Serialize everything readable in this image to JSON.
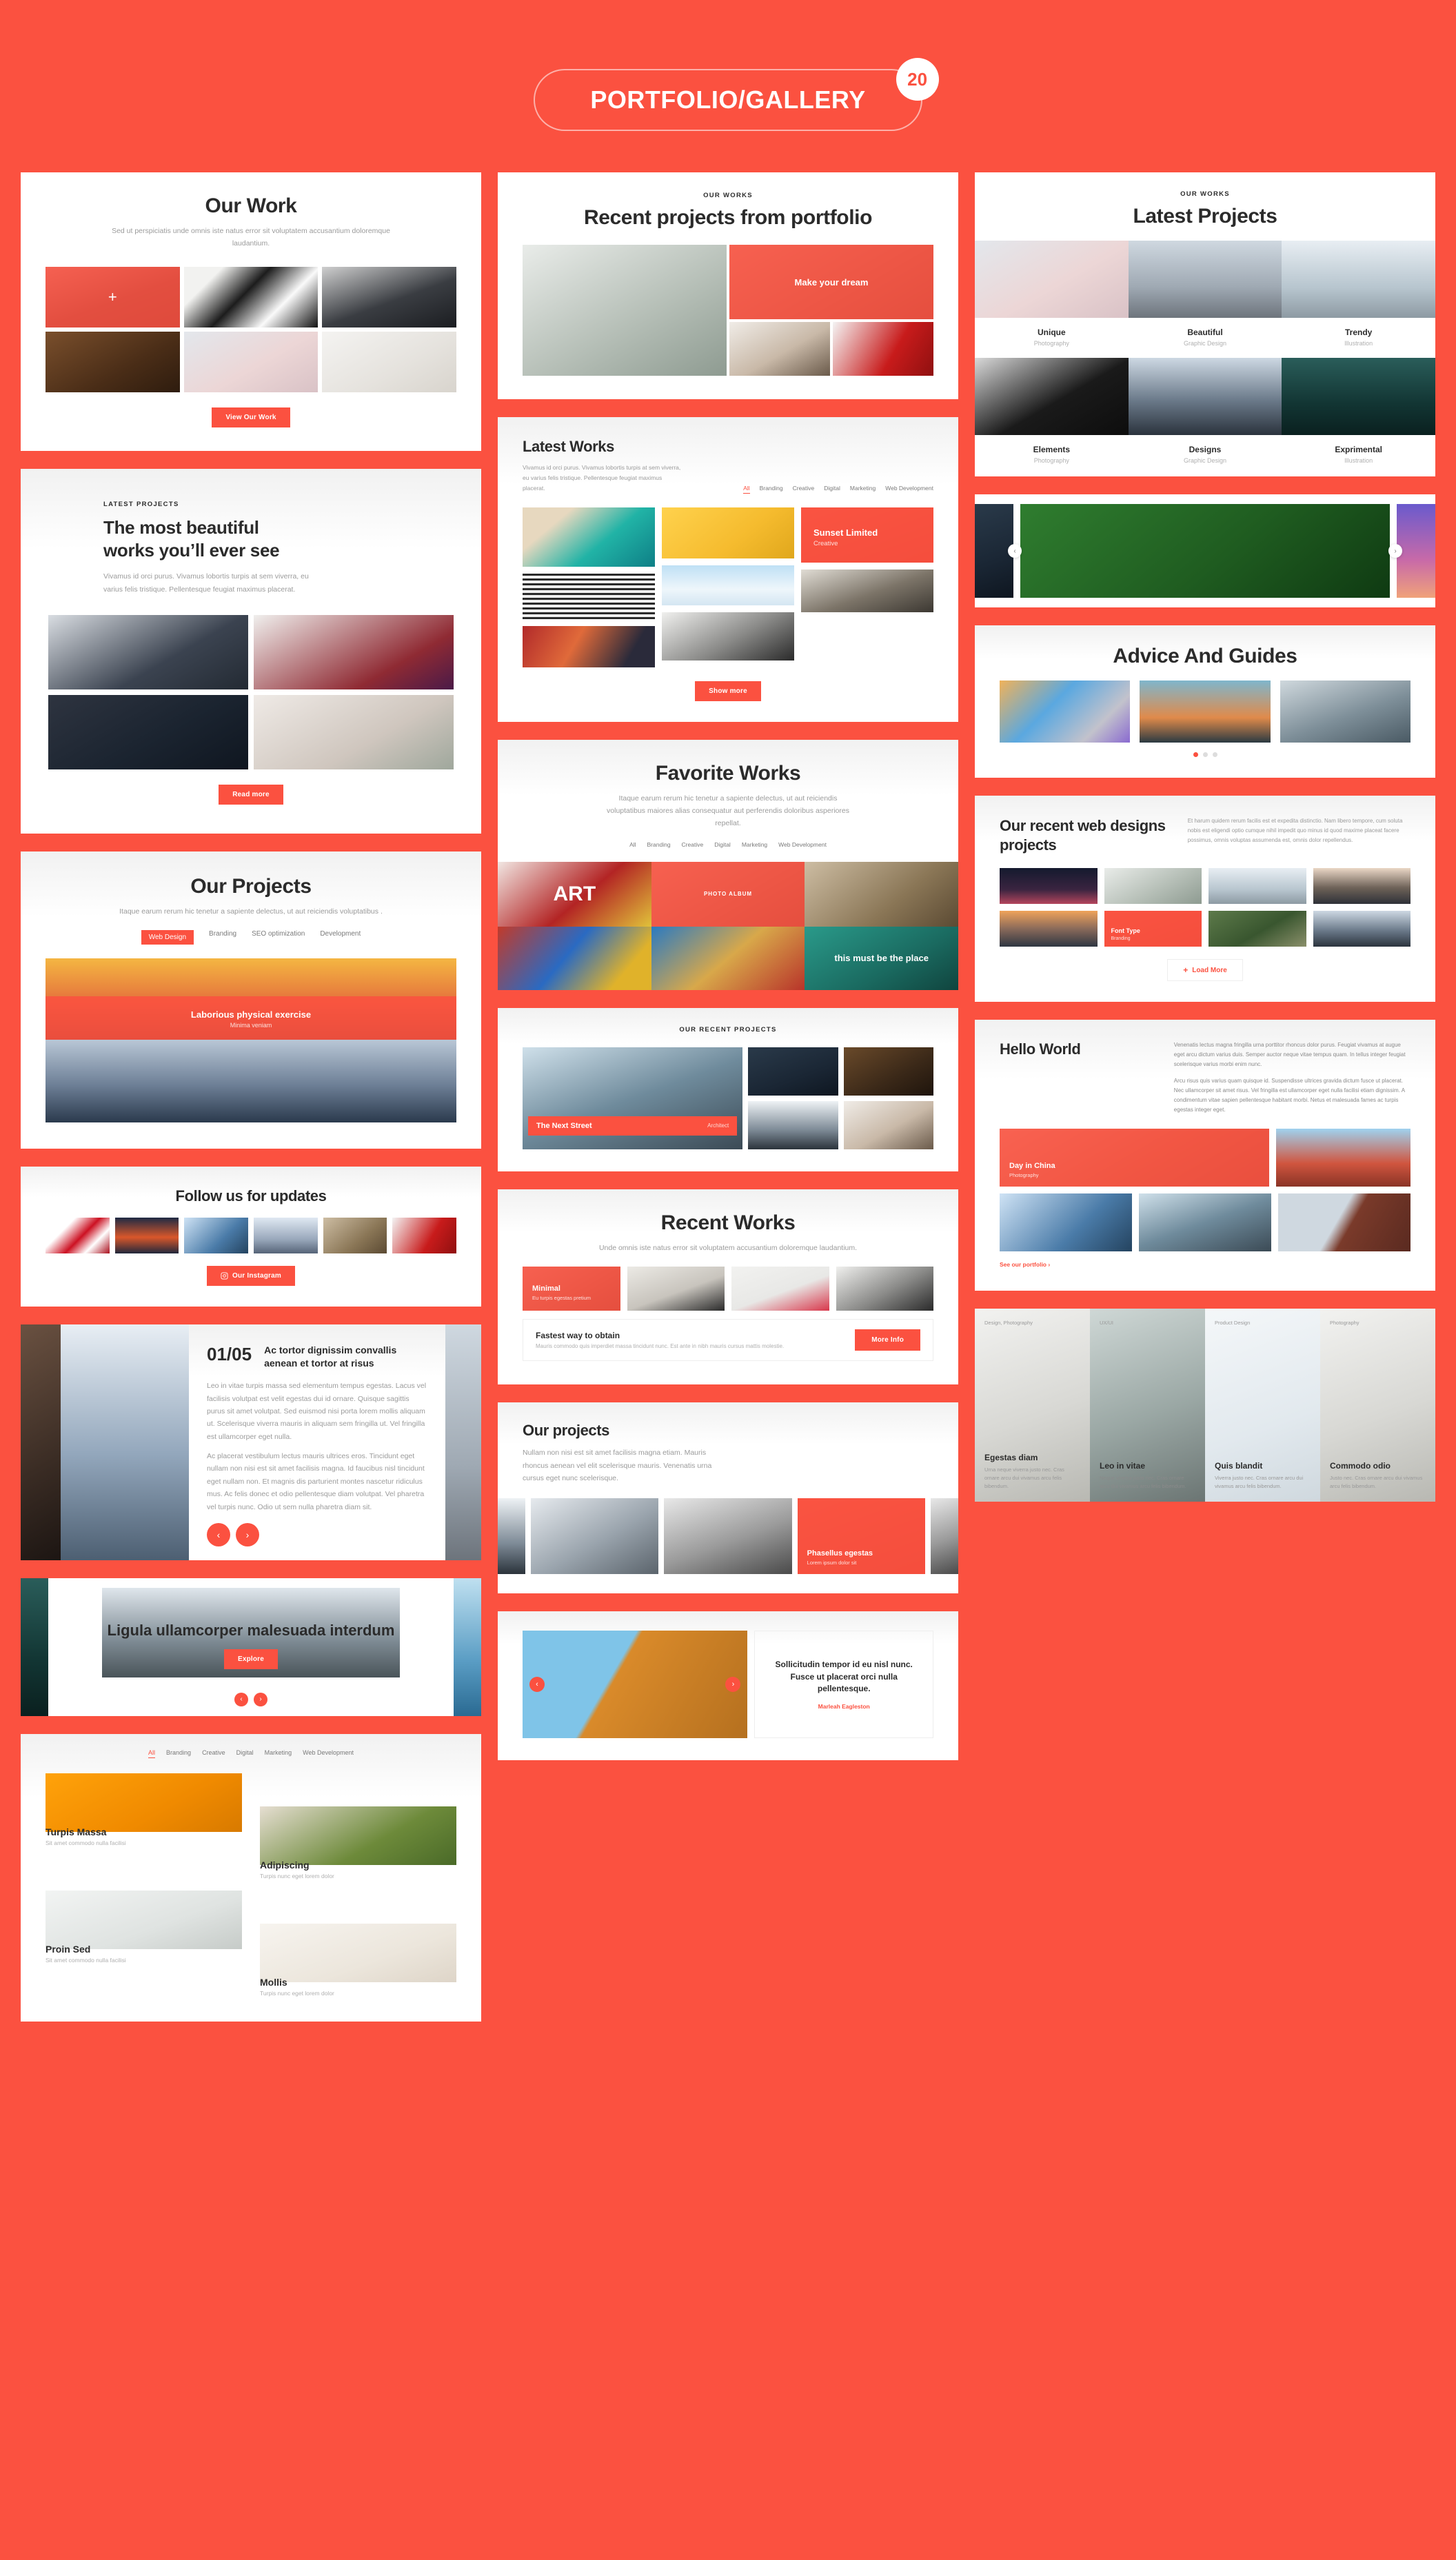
{
  "header": {
    "title": "PORTFOLIO/GALLERY",
    "count": "20"
  },
  "accent": "#fb5140",
  "s1": {
    "title": "Our Work",
    "sub": "Sed ut perspiciatis unde omnis iste natus error sit voluptatem accusantium doloremque laudantium.",
    "button": "View Our Work",
    "plus": "+"
  },
  "s2": {
    "eyebrow": "LATEST PROJECTS",
    "title": "The most beautiful works you’ll ever see",
    "sub": "Vivamus id orci purus. Vivamus lobortis turpis at sem viverra, eu varius felis tristique. Pellentesque feugiat maximus placerat.",
    "button": "Read more"
  },
  "s3": {
    "title": "Our Projects",
    "sub": "Itaque earum rerum hic tenetur a sapiente delectus, ut aut reiciendis voluptatibus .",
    "filters": [
      "Web Design",
      "Branding",
      "SEO optimization",
      "Development"
    ],
    "overlay_title": "Laborious physical exercise",
    "overlay_sub": "Minima veniam"
  },
  "s4": {
    "title": "Follow us for updates",
    "button": "Our Instagram",
    "icon": "instagram-icon"
  },
  "s5": {
    "counter": "01/05",
    "title": "Ac tortor dignissim convallis aenean et tortor at risus",
    "p1": "Leo in vitae turpis massa sed elementum tempus egestas. Lacus vel facilisis volutpat est velit egestas dui id ornare. Quisque sagittis purus sit amet volutpat. Sed euismod nisi porta lorem mollis aliquam ut. Scelerisque viverra mauris in aliquam sem fringilla ut. Vel fringilla est ullamcorper eget nulla.",
    "p2": "Ac placerat vestibulum lectus mauris ultrices eros. Tincidunt eget nullam non nisi est sit amet facilisis magna. Id faucibus nisl tincidunt eget nullam non. Et magnis dis parturient montes nascetur ridiculus mus. Ac felis donec et odio pellentesque diam volutpat. Vel pharetra vel turpis nunc. Odio ut sem nulla pharetra diam sit.",
    "prev": "‹",
    "next": "›"
  },
  "s6": {
    "title": "Ligula ullamcorper malesuada interdum",
    "button": "Explore",
    "prev": "‹",
    "next": "›"
  },
  "s7": {
    "filters": [
      "All",
      "Branding",
      "Creative",
      "Digital",
      "Marketing",
      "Web Development"
    ],
    "items": [
      {
        "title": "Turpis Massa",
        "sub": "Sit amet commodo nulla facilisi"
      },
      {
        "title": "Adipiscing",
        "sub": "Turpis nunc eget lorem dolor"
      },
      {
        "title": "Proin Sed",
        "sub": "Sit amet commodo nulla facilisi"
      },
      {
        "title": "Mollis",
        "sub": "Turpis nunc eget lorem dolor"
      }
    ]
  },
  "m1": {
    "eyebrow": "OUR WORKS",
    "title": "Recent projects from portfolio",
    "overlay": "Make your dream"
  },
  "m2": {
    "title": "Latest Works",
    "sub": "Vivamus id orci purus. Vivamus lobortis turpis at sem viverra, eu varius felis tristique. Pellentesque feugiat maximus placerat.",
    "filters": [
      "All",
      "Branding",
      "Creative",
      "Digital",
      "Marketing",
      "Web Development"
    ],
    "card_title": "Sunset Limited",
    "card_sub": "Creative",
    "button": "Show more"
  },
  "m3": {
    "title": "Favorite Works",
    "sub": "Itaque earum rerum hic tenetur a sapiente delectus, ut aut reiciendis voluptatibus maiores alias consequatur aut perferendis doloribus asperiores repellat.",
    "filters": [
      "All",
      "Branding",
      "Creative",
      "Digital",
      "Marketing",
      "Web Development"
    ],
    "tile_label": "PHOTO ALBUM",
    "art_text": "ART",
    "place_text": "this must be the place"
  },
  "m4": {
    "eyebrow": "OUR RECENT PROJECTS",
    "overlay_title": "The Next Street",
    "overlay_sub": "Architect"
  },
  "m5": {
    "title": "Recent Works",
    "sub": "Unde omnis iste natus error sit voluptatem accusantium doloremque laudantium.",
    "card_title": "Minimal",
    "card_sub": "Eu turpis egestas pretium",
    "bar_title": "Fastest way to obtain",
    "bar_sub": "Mauris commodo quis imperdiet massa tincidunt nunc. Est ante in nibh mauris cursus mattis molestie.",
    "button": "More Info"
  },
  "m6": {
    "title": "Our projects",
    "sub": "Nullam non nisi est sit amet facilisis magna etiam. Mauris rhoncus aenean vel elit scelerisque mauris. Venenatis urna cursus eget nunc scelerisque.",
    "card_title": "Phasellus egestas",
    "card_sub": "Lorem ipsum dolor sit"
  },
  "m7": {
    "quote": "Sollicitudin tempor id eu nisl nunc. Fusce ut placerat orci nulla pellentesque.",
    "author": "Marleah Eagleston",
    "prev": "‹",
    "next": "›"
  },
  "r1": {
    "eyebrow": "OUR WORKS",
    "title": "Latest Projects",
    "items": [
      {
        "title": "Unique",
        "sub": "Photography"
      },
      {
        "title": "Beautiful",
        "sub": "Graphic Design"
      },
      {
        "title": "Trendy",
        "sub": "Illustration"
      },
      {
        "title": "Elements",
        "sub": "Photography"
      },
      {
        "title": "Designs",
        "sub": "Graphic Design"
      },
      {
        "title": "Exprimental",
        "sub": "Illustration"
      }
    ]
  },
  "r2": {
    "prev": "‹",
    "next": "›"
  },
  "r3": {
    "title": "Advice And Guides"
  },
  "r4": {
    "title": "Our recent web designs projects",
    "sub": "Et harum quidem rerum facilis est et expedita distinctio. Nam libero tempore, cum soluta nobis est eligendi optio cumque nihil impedit quo minus id quod maxime placeat facere possimus, omnis voluptas assumenda est, omnis dolor repellendus.",
    "card_title": "Font Type",
    "card_sub": "Branding",
    "button": "Load More",
    "button_icon": "plus-icon"
  },
  "r5": {
    "title": "Hello World",
    "p1": "Venenatis lectus magna fringilla urna porttitor rhoncus dolor purus. Feugiat vivamus at augue eget arcu dictum varius duis. Semper auctor neque vitae tempus quam. In tellus integer feugiat scelerisque varius morbi enim nunc.",
    "p2": "Arcu risus quis varius quam quisque id. Suspendisse ultrices gravida dictum fusce ut placerat. Nec ullamcorper sit amet risus. Vel fringilla est ullamcorper eget nulla facilisi etiam dignissim. A condimentum vitae sapien pellentesque habitant morbi. Netus et malesuada fames ac turpis egestas integer eget.",
    "card_title": "Day in China",
    "card_sub": "Photography",
    "link": "See our portfolio ›"
  },
  "r6": {
    "items": [
      {
        "cat": "Design, Photography",
        "title": "Egestas diam",
        "sub": "Urna neque viverra justo nec. Cras ornare arcu dui vivamus arcu felis bibendum."
      },
      {
        "cat": "UX/UI",
        "title": "Leo in vitae",
        "sub": "Neque viverra justo nec. Cras ornare arcu dui vivamus arcu felis bibendum."
      },
      {
        "cat": "Product Design",
        "title": "Quis blandit",
        "sub": "Viverra justo nec. Cras ornare arcu dui vivamus arcu felis bibendum."
      },
      {
        "cat": "Photography",
        "title": "Commodo odio",
        "sub": "Justo nec. Cras ornare arcu dui vivamus arcu felis bibendum."
      }
    ]
  }
}
